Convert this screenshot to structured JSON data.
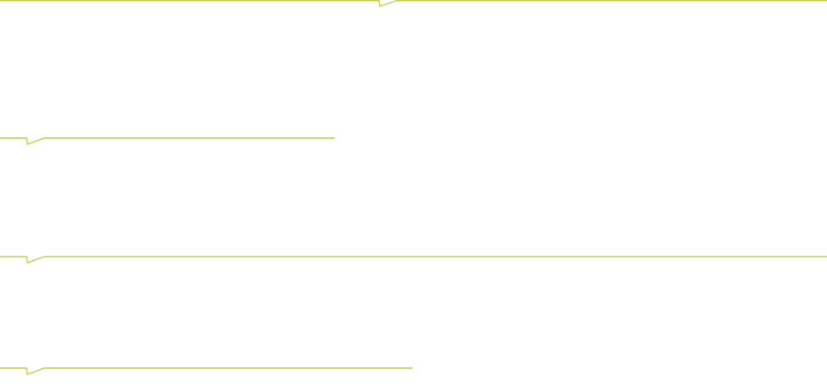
{
  "colors": {
    "accent": "#c2cf4c",
    "background": "#ffffff"
  },
  "dividers": [
    {
      "name": "divider-top",
      "style": "notched-line"
    },
    {
      "name": "divider-second",
      "style": "notched-line"
    },
    {
      "name": "divider-third",
      "style": "notched-line"
    },
    {
      "name": "divider-bottom",
      "style": "notched-line"
    }
  ]
}
